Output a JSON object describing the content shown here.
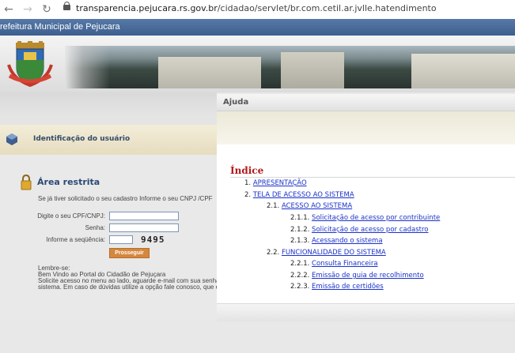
{
  "browser": {
    "back_icon": "back-arrow-icon",
    "forward_icon": "forward-arrow-icon",
    "reload_icon": "reload-icon",
    "url_domain": "transparencia.pejucara.rs.gov.br",
    "url_path": "/cidadao/servlet/br.com.cetil.ar.jvlle.hatendimento"
  },
  "header": {
    "title": "refeitura Municipal de Pejucara"
  },
  "login": {
    "section_label": "Identificação do usuário",
    "area_title": "Área restrita",
    "intro": "Se já tiver solicitado o seu cadastro Informe o seu CNPJ /CPF",
    "cpf_label": "Digite o seu CPF/CNPJ:",
    "cpf_value": "",
    "password_label": "Senha:",
    "password_value": "",
    "sequence_label": "Informe a seqüência:",
    "sequence_value": "",
    "captcha": "9495",
    "submit_label": "Prosseguir",
    "reminder_title": "Lembre-se:",
    "reminder_line1": "Bem Vindo ao Portal do Cidadão de Pejuçara",
    "reminder_line2": "Solicite acesso no menu ao lado, aguarde e-mail com sua senha",
    "reminder_line3": "sistema. Em caso de dúvidas utilize a opção fale conosco, que e"
  },
  "help": {
    "title": "Ajuda",
    "index_title": "Índice",
    "items": [
      {
        "num": "1.",
        "label": "APRESENTAÇÃO"
      },
      {
        "num": "2.",
        "label": "TELA DE ACESSO AO SISTEMA"
      },
      {
        "num": "2.1.",
        "label": "ACESSO AO SISTEMA"
      },
      {
        "num": "2.1.1.",
        "label": "Solicitação de acesso por contribuinte"
      },
      {
        "num": "2.1.2.",
        "label": "Solicitação de acesso por cadastro"
      },
      {
        "num": "2.1.3.",
        "label": "Acessando o sistema"
      },
      {
        "num": "2.2.",
        "label": "FUNCIONALIDADE DO SISTEMA"
      },
      {
        "num": "2.2.1.",
        "label": "Consulta Financeira"
      },
      {
        "num": "2.2.2.",
        "label": "Emissão de guia de recolhimento"
      },
      {
        "num": "2.2.3.",
        "label": "Emissão de certidões"
      }
    ]
  }
}
